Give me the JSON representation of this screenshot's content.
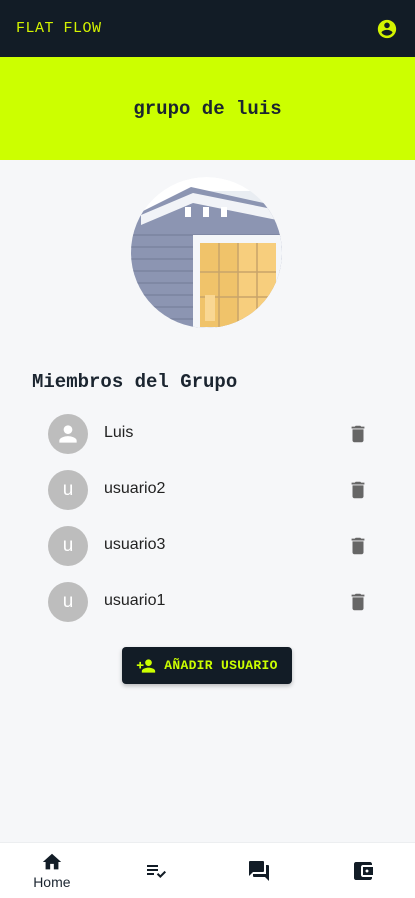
{
  "app": {
    "brand": "FLAT FLOW"
  },
  "group": {
    "name": "grupo de luis"
  },
  "members_section": {
    "title": "Miembros del Grupo"
  },
  "members": [
    {
      "name": "Luis",
      "avatar_initial": "",
      "avatar_icon": "person-icon"
    },
    {
      "name": "usuario2",
      "avatar_initial": "u"
    },
    {
      "name": "usuario3",
      "avatar_initial": "u"
    },
    {
      "name": "usuario1",
      "avatar_initial": "u"
    }
  ],
  "actions": {
    "add_user": "AÑADIR USUARIO"
  },
  "bottom_nav": [
    {
      "label": "Home",
      "icon": "home-icon"
    },
    {
      "label": "",
      "icon": "tasks-icon"
    },
    {
      "label": "",
      "icon": "chat-icon"
    },
    {
      "label": "",
      "icon": "wallet-icon"
    }
  ],
  "colors": {
    "dark": "#121c26",
    "accent": "#ccff00",
    "background": "#f6f7f9",
    "avatar": "#bdbdbd",
    "trash": "#666666"
  }
}
